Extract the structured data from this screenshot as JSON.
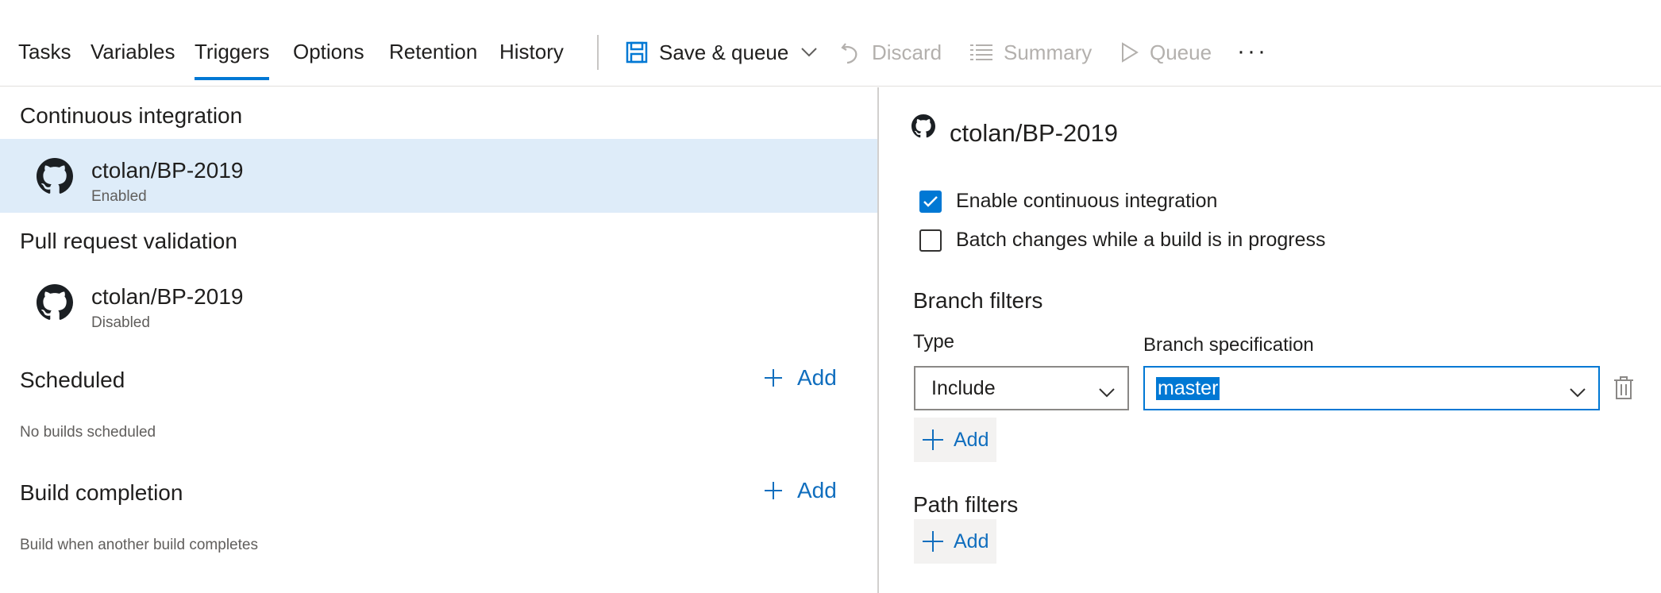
{
  "toolbar": {
    "tabs": [
      {
        "label": "Tasks",
        "active": false
      },
      {
        "label": "Variables",
        "active": false
      },
      {
        "label": "Triggers",
        "active": true
      },
      {
        "label": "Options",
        "active": false
      },
      {
        "label": "Retention",
        "active": false
      },
      {
        "label": "History",
        "active": false
      }
    ],
    "save_queue_label": "Save & queue",
    "discard_label": "Discard",
    "summary_label": "Summary",
    "queue_label": "Queue",
    "more_label": "···"
  },
  "left": {
    "ci": {
      "title": "Continuous integration",
      "repo": {
        "name": "ctolan/BP-2019",
        "status": "Enabled"
      }
    },
    "pr": {
      "title": "Pull request validation",
      "repo": {
        "name": "ctolan/BP-2019",
        "status": "Disabled"
      }
    },
    "scheduled": {
      "title": "Scheduled",
      "add_label": "Add",
      "empty_text": "No builds scheduled"
    },
    "build_completion": {
      "title": "Build completion",
      "add_label": "Add",
      "empty_text": "Build when another build completes"
    }
  },
  "right": {
    "repo_name": "ctolan/BP-2019",
    "enable_ci": {
      "label": "Enable continuous integration",
      "checked": true
    },
    "batch_changes": {
      "label": "Batch changes while a build is in progress",
      "checked": false
    },
    "branch_filters": {
      "heading": "Branch filters",
      "type_label": "Type",
      "spec_label": "Branch specification",
      "type_value": "Include",
      "spec_value": "master",
      "add_label": "Add"
    },
    "path_filters": {
      "heading": "Path filters",
      "add_label": "Add"
    }
  },
  "colors": {
    "accent": "#0078d4",
    "link": "#106ebe",
    "selected_row": "#deecf9",
    "disabled_text": "#b3b0ad"
  }
}
